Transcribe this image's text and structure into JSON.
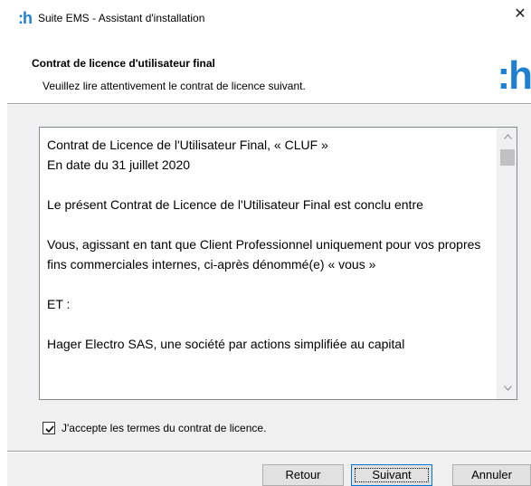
{
  "window": {
    "title": "Suite EMS - Assistant d'installation",
    "app_icon_text": ":h",
    "close_glyph": "✕"
  },
  "header": {
    "title": "Contrat de licence d'utilisateur final",
    "subtitle": "Veuillez lire attentivement le contrat de licence suivant.",
    "logo_text": ":h",
    "logo_color": "#1f7fd0"
  },
  "license": {
    "paragraphs": [
      "Contrat de Licence de l'Utilisateur Final, « CLUF »",
      "En date du 31 juillet 2020",
      "Le présent Contrat de Licence de l'Utilisateur Final est conclu entre",
      "Vous, agissant en tant que Client Professionnel uniquement pour vos propres fins commerciales internes, ci-après dénommé(e) « vous »",
      "ET :",
      "Hager Electro SAS, une société par actions simplifiée au capital"
    ]
  },
  "accept": {
    "label": "J'accepte les termes du contrat de licence.",
    "checked": true
  },
  "buttons": {
    "back": "Retour",
    "next": "Suivant",
    "cancel": "Annuler"
  },
  "icons": {
    "scroll_up": "chevron-up-icon",
    "scroll_down": "chevron-down-icon",
    "check": "checkmark-icon",
    "close": "close-icon"
  }
}
